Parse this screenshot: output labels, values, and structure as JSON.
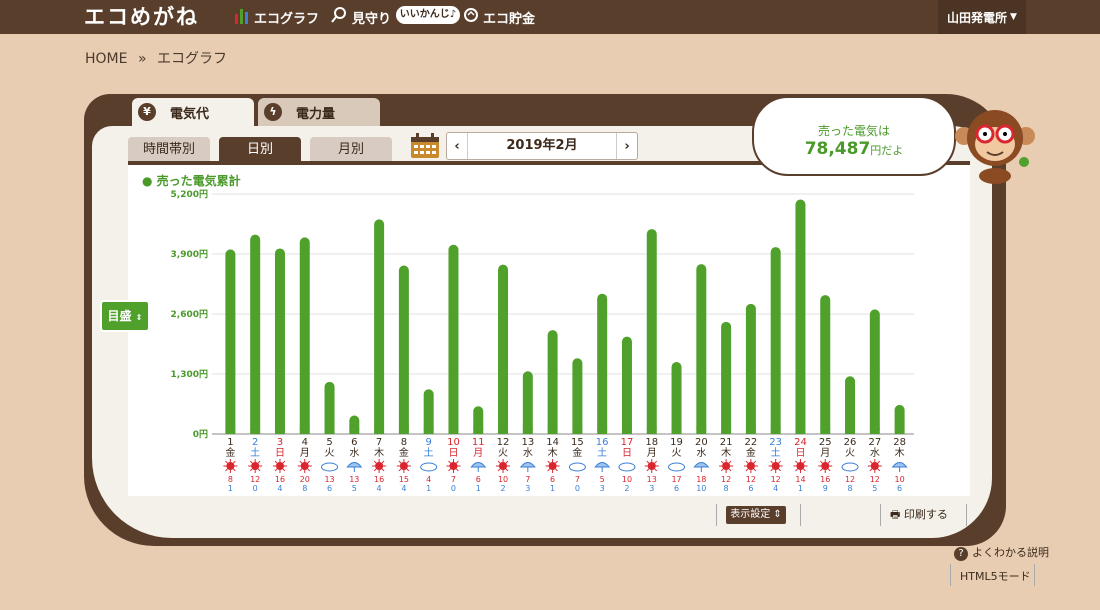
{
  "app": {
    "title": "エコめがね"
  },
  "nav": {
    "graph": "エコグラフ",
    "mimamori": "見守り",
    "mimamori_pill": "いいかんじ♪",
    "chokin": "エコ貯金"
  },
  "user": {
    "name": "山田発電所"
  },
  "breadcrumb": {
    "home": "HOME",
    "sep": "»",
    "current": "エコグラフ"
  },
  "tabs": {
    "denkidai": "電気代",
    "denryoku": "電力量"
  },
  "period": {
    "hourly": "時間帯別",
    "daily": "日別",
    "monthly": "月別"
  },
  "month_nav": {
    "prev": "‹",
    "label": "2019年2月",
    "next": "›"
  },
  "bubble": {
    "line1": "売った電気は",
    "value": "78,487",
    "unit": "円だよ"
  },
  "side": {
    "meyasu": "目盛"
  },
  "footer": {
    "display_settings": "表示設定",
    "print": "印刷する",
    "help": "よくわかる説明",
    "html5": "HTML5モード"
  },
  "colors": {
    "bar": "#4fa12c",
    "accent": "#5a3e2c",
    "sun": "#d9262f",
    "weekday_sat": "#3a7ed6",
    "weekday_sun": "#d9262f"
  },
  "chart_data": {
    "type": "bar",
    "title": "売った電気累計",
    "ylim": [
      0,
      5200
    ],
    "yticks": [
      "0円",
      "1,300円",
      "2,600円",
      "3,900円",
      "5,200円"
    ],
    "ytick_values": [
      0,
      1300,
      2600,
      3900,
      5200
    ],
    "days": [
      {
        "d": "1",
        "w": "金",
        "v": 4000,
        "wx": "sun",
        "hi": "8",
        "lo": "1"
      },
      {
        "d": "2",
        "w": "土",
        "v": 4320,
        "wx": "sun",
        "hi": "12",
        "lo": "0"
      },
      {
        "d": "3",
        "w": "日",
        "v": 4020,
        "wx": "sun",
        "hi": "16",
        "lo": "4"
      },
      {
        "d": "4",
        "w": "月",
        "v": 4260,
        "wx": "sun-rain",
        "hi": "20",
        "lo": "8"
      },
      {
        "d": "5",
        "w": "火",
        "v": 1130,
        "wx": "cloud",
        "hi": "13",
        "lo": "6"
      },
      {
        "d": "6",
        "w": "水",
        "v": 400,
        "wx": "umbrella",
        "hi": "13",
        "lo": "5"
      },
      {
        "d": "7",
        "w": "木",
        "v": 4650,
        "wx": "sun",
        "hi": "16",
        "lo": "4"
      },
      {
        "d": "8",
        "w": "金",
        "v": 3650,
        "wx": "sun",
        "hi": "15",
        "lo": "4"
      },
      {
        "d": "9",
        "w": "土",
        "v": 970,
        "wx": "cloud",
        "hi": "4",
        "lo": "1"
      },
      {
        "d": "10",
        "w": "日",
        "v": 4100,
        "wx": "sun",
        "hi": "7",
        "lo": "0"
      },
      {
        "d": "11",
        "w": "月",
        "v": 600,
        "wx": "umbrella",
        "hi": "6",
        "lo": "1"
      },
      {
        "d": "12",
        "w": "火",
        "v": 3670,
        "wx": "sun",
        "hi": "10",
        "lo": "2"
      },
      {
        "d": "13",
        "w": "水",
        "v": 1360,
        "wx": "umbrella",
        "hi": "7",
        "lo": "3"
      },
      {
        "d": "14",
        "w": "木",
        "v": 2250,
        "wx": "sun",
        "hi": "6",
        "lo": "1"
      },
      {
        "d": "15",
        "w": "金",
        "v": 1640,
        "wx": "cloud",
        "hi": "7",
        "lo": "0"
      },
      {
        "d": "16",
        "w": "土",
        "v": 3040,
        "wx": "umbrella",
        "hi": "5",
        "lo": "3"
      },
      {
        "d": "17",
        "w": "日",
        "v": 2110,
        "wx": "cloud",
        "hi": "10",
        "lo": "2"
      },
      {
        "d": "18",
        "w": "月",
        "v": 4440,
        "wx": "sun",
        "hi": "13",
        "lo": "3"
      },
      {
        "d": "19",
        "w": "火",
        "v": 1560,
        "wx": "cloud",
        "hi": "17",
        "lo": "6"
      },
      {
        "d": "20",
        "w": "水",
        "v": 3680,
        "wx": "umbrella",
        "hi": "18",
        "lo": "10"
      },
      {
        "d": "21",
        "w": "木",
        "v": 2430,
        "wx": "sun",
        "hi": "12",
        "lo": "8"
      },
      {
        "d": "22",
        "w": "金",
        "v": 2820,
        "wx": "sun",
        "hi": "12",
        "lo": "6"
      },
      {
        "d": "23",
        "w": "土",
        "v": 4050,
        "wx": "sun",
        "hi": "12",
        "lo": "4"
      },
      {
        "d": "24",
        "w": "日",
        "v": 5080,
        "wx": "sun",
        "hi": "14",
        "lo": "1"
      },
      {
        "d": "25",
        "w": "月",
        "v": 3010,
        "wx": "sun",
        "hi": "16",
        "lo": "9"
      },
      {
        "d": "26",
        "w": "火",
        "v": 1250,
        "wx": "cloud",
        "hi": "12",
        "lo": "8"
      },
      {
        "d": "27",
        "w": "水",
        "v": 2700,
        "wx": "sun",
        "hi": "12",
        "lo": "5"
      },
      {
        "d": "28",
        "w": "木",
        "v": 630,
        "wx": "umbrella",
        "hi": "10",
        "lo": "6"
      }
    ]
  }
}
